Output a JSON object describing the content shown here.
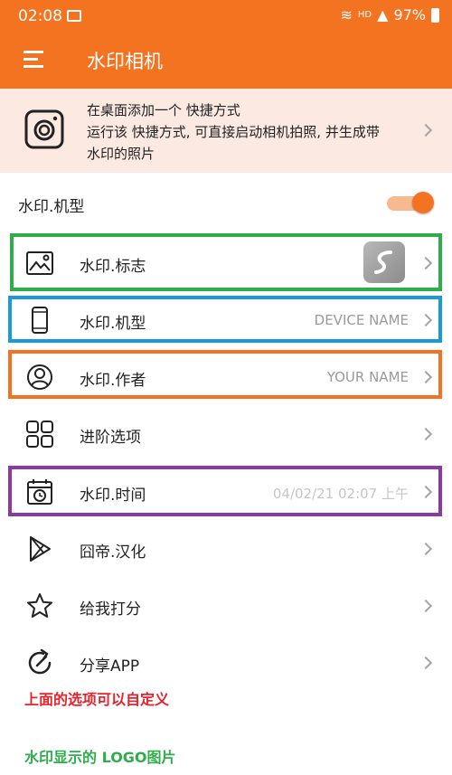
{
  "status_bar": {
    "time": "02:08",
    "network": "HD",
    "battery": "97%"
  },
  "app_bar": {
    "title": "水印相机"
  },
  "banner": {
    "line1": "在桌面添加一个 快捷方式",
    "line2": "运行该 快捷方式, 可直接启动相机拍照, 并生成带",
    "line3": "水印的照片"
  },
  "section": {
    "label": "水印.机型"
  },
  "items": [
    {
      "label": "水印.标志",
      "value": ""
    },
    {
      "label": "水印.机型",
      "value": "DEVICE NAME"
    },
    {
      "label": "水印.作者",
      "value": "YOUR NAME"
    },
    {
      "label": "进阶选项",
      "value": ""
    },
    {
      "label": "水印.时间",
      "value": "04/02/21 02:07 上午"
    },
    {
      "label": "囧帝.汉化",
      "value": ""
    },
    {
      "label": "给我打分",
      "value": ""
    },
    {
      "label": "分享APP",
      "value": ""
    }
  ],
  "annotations": {
    "red_note": "上面的选项可以自定义",
    "green_note": "水印显示的 LOGO图片"
  },
  "colors": {
    "accent": "#f37321",
    "green": "#2eae4a",
    "blue": "#1a9ad9",
    "orange": "#f37321",
    "purple": "#8a3aa8",
    "red": "#e8222a"
  }
}
